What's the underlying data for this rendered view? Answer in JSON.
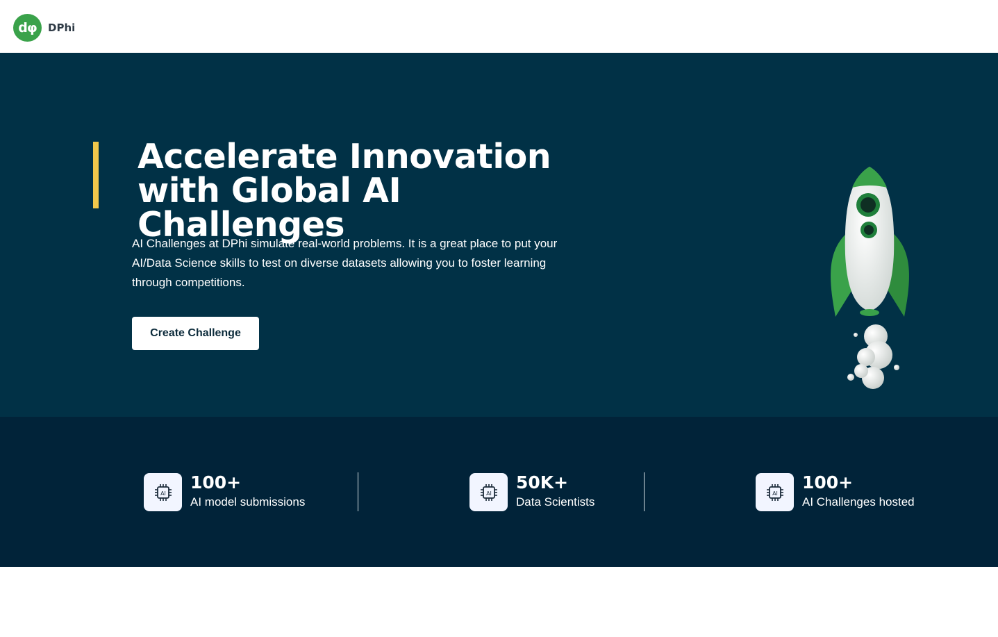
{
  "brand": {
    "logo_mark": "dφ",
    "name": "DPhi"
  },
  "hero": {
    "title_line1": "Accelerate Innovation",
    "title_line2": "with Global AI Challenges",
    "description": "AI Challenges at DPhi simulate real-world problems. It is a great place to put your AI/Data Science skills to test on diverse datasets allowing you to foster learning through competitions.",
    "cta_label": "Create Challenge",
    "illustration": "rocket-icon"
  },
  "stats": [
    {
      "icon": "ai-chip-icon",
      "value": "100+",
      "label": "AI model submissions"
    },
    {
      "icon": "ai-chip-icon",
      "value": "50K+",
      "label": "Data Scientists"
    },
    {
      "icon": "ai-chip-icon",
      "value": "100+",
      "label": "AI Challenges hosted"
    }
  ],
  "colors": {
    "hero_bg": "#013146",
    "stats_bg": "#012339",
    "accent_bar": "#f2c84b",
    "brand_green": "#3aa24a"
  }
}
